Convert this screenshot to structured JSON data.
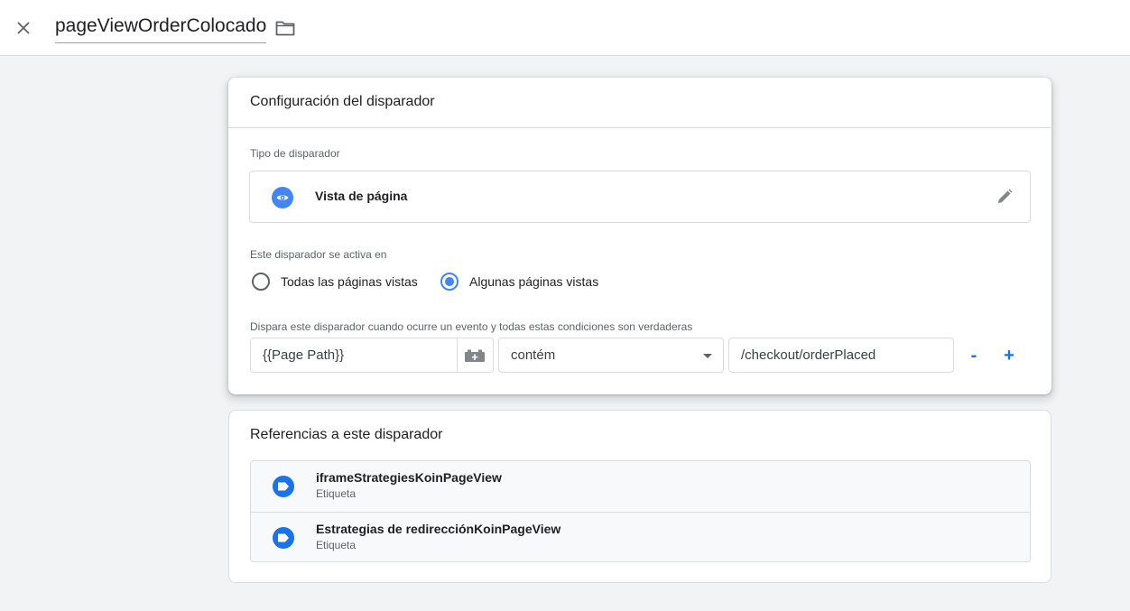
{
  "header": {
    "title": "pageViewOrderColocado",
    "close_icon": "close-icon",
    "folder_icon": "folder-icon"
  },
  "config_card": {
    "title": "Configuración del disparador",
    "type_label": "Tipo de disparador",
    "type_name": "Vista de página",
    "type_icon": "eye-icon",
    "edit_icon": "pencil-icon",
    "fires_on_label": "Este disparador se activa en",
    "options": [
      {
        "label": "Todas las páginas vistas",
        "selected": false
      },
      {
        "label": "Algunas páginas vistas",
        "selected": true
      }
    ],
    "condition_label": "Dispara este disparador cuando ocurre un evento y todas estas condiciones son verdaderas",
    "condition": {
      "variable": "{{Page Path}}",
      "operator": "contém",
      "value": "/checkout/orderPlaced",
      "remove_label": "-",
      "add_label": "+"
    }
  },
  "refs_card": {
    "title": "Referencias a este disparador",
    "items": [
      {
        "name": "iframeStrategiesKoinPageView",
        "type": "Etiqueta"
      },
      {
        "name": "Estrategias de redirecciónKoinPageView",
        "type": "Etiqueta"
      }
    ]
  },
  "colors": {
    "accent": "#1a73e8",
    "eye_badge": "#4285f4",
    "background": "#f1f3f4"
  }
}
